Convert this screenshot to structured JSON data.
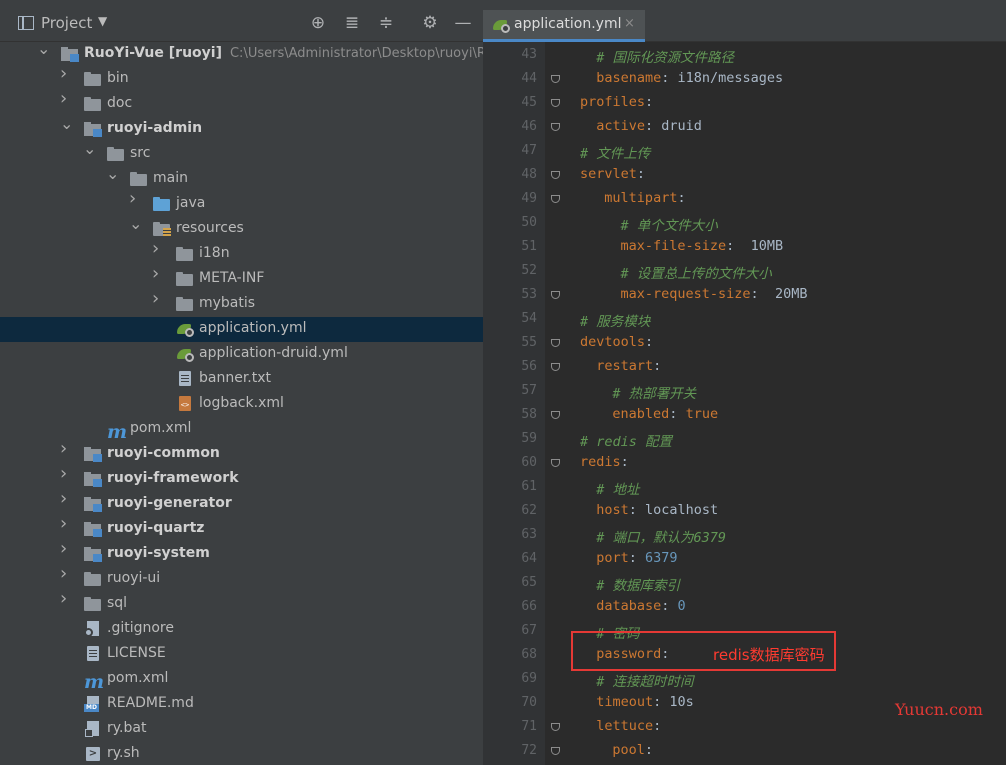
{
  "project_panel": {
    "title": "Project",
    "toolbar": [
      "locate-icon",
      "expand-all-icon",
      "collapse-all-icon",
      "settings-icon",
      "hide-icon"
    ],
    "tree": [
      {
        "label": "RuoYi-Vue [ruoyi]",
        "path": "C:\\Users\\Administrator\\Desktop\\ruoyi\\RuoYi",
        "bold": true,
        "icon": "module",
        "depth": 0,
        "expanded": true
      },
      {
        "label": "bin",
        "icon": "folder",
        "depth": 1,
        "expanded": false
      },
      {
        "label": "doc",
        "icon": "folder",
        "depth": 1,
        "expanded": false
      },
      {
        "label": "ruoyi-admin",
        "bold": true,
        "icon": "module",
        "depth": 1,
        "expanded": true
      },
      {
        "label": "src",
        "icon": "folder",
        "depth": 2,
        "expanded": true
      },
      {
        "label": "main",
        "icon": "folder",
        "depth": 3,
        "expanded": true
      },
      {
        "label": "java",
        "icon": "folder-blue",
        "depth": 4,
        "expanded": false
      },
      {
        "label": "resources",
        "icon": "resources",
        "depth": 4,
        "expanded": true
      },
      {
        "label": "i18n",
        "icon": "folder",
        "depth": 5,
        "expanded": false
      },
      {
        "label": "META-INF",
        "icon": "folder",
        "depth": 5,
        "expanded": false
      },
      {
        "label": "mybatis",
        "icon": "folder",
        "depth": 5,
        "expanded": false
      },
      {
        "label": "application.yml",
        "icon": "spring",
        "depth": 5,
        "selected": true
      },
      {
        "label": "application-druid.yml",
        "icon": "spring",
        "depth": 5
      },
      {
        "label": "banner.txt",
        "icon": "text",
        "depth": 5
      },
      {
        "label": "logback.xml",
        "icon": "xml",
        "depth": 5
      },
      {
        "label": "pom.xml",
        "icon": "maven",
        "depth": 2
      },
      {
        "label": "ruoyi-common",
        "bold": true,
        "icon": "module",
        "depth": 1,
        "expanded": false
      },
      {
        "label": "ruoyi-framework",
        "bold": true,
        "icon": "module",
        "depth": 1,
        "expanded": false
      },
      {
        "label": "ruoyi-generator",
        "bold": true,
        "icon": "module",
        "depth": 1,
        "expanded": false
      },
      {
        "label": "ruoyi-quartz",
        "bold": true,
        "icon": "module",
        "depth": 1,
        "expanded": false
      },
      {
        "label": "ruoyi-system",
        "bold": true,
        "icon": "module",
        "depth": 1,
        "expanded": false
      },
      {
        "label": "ruoyi-ui",
        "icon": "folder",
        "depth": 1,
        "expanded": false
      },
      {
        "label": "sql",
        "icon": "folder",
        "depth": 1,
        "expanded": false
      },
      {
        "label": ".gitignore",
        "icon": "gitignore",
        "depth": 1
      },
      {
        "label": "LICENSE",
        "icon": "text",
        "depth": 1
      },
      {
        "label": "pom.xml",
        "icon": "maven",
        "depth": 1
      },
      {
        "label": "README.md",
        "icon": "markdown",
        "depth": 1
      },
      {
        "label": "ry.bat",
        "icon": "bat",
        "depth": 1
      },
      {
        "label": "ry.sh",
        "icon": "shell",
        "depth": 1
      }
    ]
  },
  "editor": {
    "tab": {
      "label": "application.yml",
      "close": "×"
    },
    "lines": [
      {
        "n": "43",
        "indent": 1,
        "comment": "# 国际化资源文件路径"
      },
      {
        "n": "44",
        "indent": 1,
        "key": "basename",
        "value": "i18n/messages",
        "fold": true
      },
      {
        "n": "45",
        "indent": 0,
        "key": "profiles",
        "fold": true
      },
      {
        "n": "46",
        "indent": 1,
        "key": "active",
        "value": "druid",
        "fold": true
      },
      {
        "n": "47",
        "indent": 0,
        "comment": "# 文件上传"
      },
      {
        "n": "48",
        "indent": 0,
        "key": "servlet",
        "fold": true
      },
      {
        "n": "49",
        "indent": 1.5,
        "key": "multipart",
        "fold": true
      },
      {
        "n": "50",
        "indent": 2.5,
        "comment": "# 单个文件大小"
      },
      {
        "n": "51",
        "indent": 2.5,
        "key": "max-file-size",
        "value": " 10MB"
      },
      {
        "n": "52",
        "indent": 2.5,
        "comment": "# 设置总上传的文件大小"
      },
      {
        "n": "53",
        "indent": 2.5,
        "key": "max-request-size",
        "value": " 20MB",
        "fold": true
      },
      {
        "n": "54",
        "indent": 0,
        "comment": "# 服务模块"
      },
      {
        "n": "55",
        "indent": 0,
        "key": "devtools",
        "fold": true
      },
      {
        "n": "56",
        "indent": 1,
        "key": "restart",
        "fold": true
      },
      {
        "n": "57",
        "indent": 2,
        "comment": "# 热部署开关"
      },
      {
        "n": "58",
        "indent": 2,
        "key": "enabled",
        "value": "true",
        "vclass": "k",
        "fold": true
      },
      {
        "n": "59",
        "indent": 0,
        "comment": "# redis 配置"
      },
      {
        "n": "60",
        "indent": 0,
        "key": "redis",
        "fold": true
      },
      {
        "n": "61",
        "indent": 1,
        "comment": "# 地址"
      },
      {
        "n": "62",
        "indent": 1,
        "key": "host",
        "value": "localhost"
      },
      {
        "n": "63",
        "indent": 1,
        "comment": "# 端口，默认为6379"
      },
      {
        "n": "64",
        "indent": 1,
        "key": "port",
        "value": "6379",
        "vclass": "n"
      },
      {
        "n": "65",
        "indent": 1,
        "comment": "# 数据库索引"
      },
      {
        "n": "66",
        "indent": 1,
        "key": "database",
        "value": "0",
        "vclass": "n"
      },
      {
        "n": "67",
        "indent": 1,
        "comment": "# 密码"
      },
      {
        "n": "68",
        "indent": 1,
        "key": "password",
        "value": ""
      },
      {
        "n": "69",
        "indent": 1,
        "comment": "# 连接超时时间"
      },
      {
        "n": "70",
        "indent": 1,
        "key": "timeout",
        "value": "10s"
      },
      {
        "n": "71",
        "indent": 1,
        "key": "lettuce",
        "fold": true
      },
      {
        "n": "72",
        "indent": 2,
        "key": "pool",
        "fold": true
      }
    ]
  },
  "annotation": {
    "text": "redis数据库密码",
    "color": "#e53935"
  },
  "watermark": {
    "text": "Yuucn.com"
  },
  "colors": {
    "keyword": "#cc7832",
    "comment": "#629755",
    "number": "#6897bb",
    "selection": "#0d293e"
  }
}
